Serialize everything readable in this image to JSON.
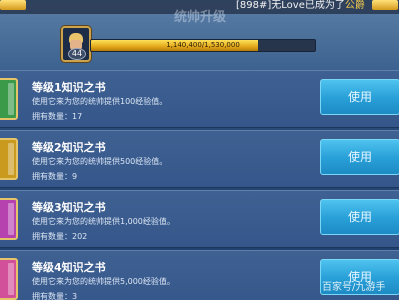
{
  "notice": {
    "prefix": "[898#]",
    "player": "无Love",
    "middle": "已成为了",
    "rank": "公爵"
  },
  "header": {
    "title": "统帅升级"
  },
  "commander": {
    "level": "44",
    "xp_text": "1,140,400/1,530,000",
    "xp_progress": 0.745
  },
  "colors": {
    "book_1": "#3a9a4a",
    "book_2": "#c99a1e",
    "book_3": "#b642b0",
    "book_4": "#d24f9a",
    "use_button": "#2aa1d9"
  },
  "items": [
    {
      "name": "等级1知识之书",
      "desc": "使用它来为您的统帅提供100经验值。",
      "count_label": "拥有数量：",
      "count": "17",
      "button": "使用",
      "icon": "book-icon"
    },
    {
      "name": "等级2知识之书",
      "desc": "使用它来为您的统帅提供500经验值。",
      "count_label": "拥有数量：",
      "count": "9",
      "button": "使用",
      "icon": "book-icon"
    },
    {
      "name": "等级3知识之书",
      "desc": "使用它来为您的统帅提供1,000经验值。",
      "count_label": "拥有数量：",
      "count": "202",
      "button": "使用",
      "icon": "book-icon"
    },
    {
      "name": "等级4知识之书",
      "desc": "使用它来为您的统帅提供5,000经验值。",
      "count_label": "拥有数量：",
      "count": "3",
      "button": "使用",
      "icon": "book-icon"
    }
  ],
  "watermark": "百家号/九游手"
}
